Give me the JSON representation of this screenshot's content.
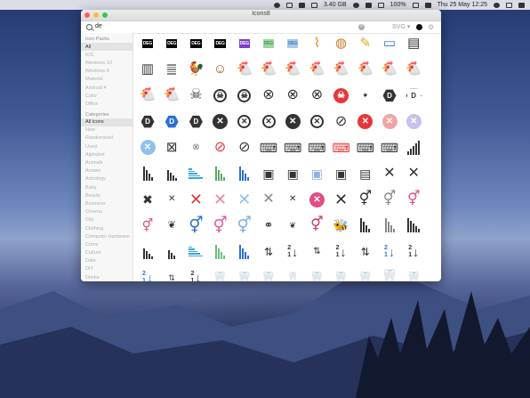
{
  "menubar": {
    "status": [
      "3.40 GB",
      "100%"
    ],
    "datetime": "Thu 25 May  12:25"
  },
  "window": {
    "title": "Icons8",
    "search": {
      "value": "de",
      "clear_label": "×"
    },
    "format": "SVG",
    "format_chevron": "▾",
    "gear_label": "⚙"
  },
  "sidebar": {
    "icon_packs_header": "Icon Packs",
    "packs": [
      "All",
      "iOS",
      "Windows 10",
      "Windows 8",
      "Material",
      "Android 4",
      "Color",
      "Office"
    ],
    "categories_header": "Categories",
    "categories": [
      "All Icons",
      "New",
      "Randomized",
      "Used",
      "Alphabet",
      "Animals",
      "Arrows",
      "Astrology",
      "Baby",
      "Beauty",
      "Business",
      "Cinema",
      "City",
      "Clothing",
      "Computer Hardware",
      "Crime",
      "Culture",
      "Data",
      "DIY",
      "Drinks",
      "Ecommerce",
      "Editing"
    ]
  },
  "icons": {
    "deg_label": "DEG",
    "deg_colors": [
      "#000000",
      "#000000",
      "#000000",
      "#000000",
      "#7b3fd0",
      "#9ed6a0",
      "#a8c9ec"
    ],
    "deg_text_colors": [
      "#ffffff",
      "#ffffff",
      "#ffffff",
      "#ffffff",
      "#ffffff",
      "#4b9a4f",
      "#4a7ab8"
    ],
    "letter_d": "D",
    "cross": "✕",
    "no_symbol": "⊘",
    "skull": "☠",
    "hen": "🐔",
    "chicken_face": "🐓",
    "sort_num_top": "2",
    "sort_num_bottom": "1",
    "arrow_down": "↓",
    "gender": "⚥",
    "bee": "🐝"
  },
  "colors": {
    "red": "#e8353a",
    "blue": "#2a6fd6",
    "pink": "#e04e86",
    "lightblue": "#8fc1ef",
    "dark": "#333333"
  }
}
